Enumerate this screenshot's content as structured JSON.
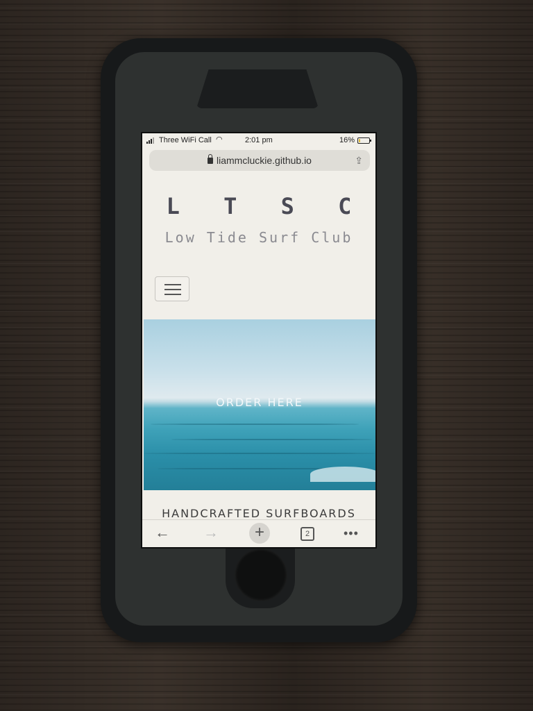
{
  "status_bar": {
    "carrier": "Three WiFi Call",
    "time": "2:01 pm",
    "battery_percent": "16%",
    "battery_level": 0.16
  },
  "browser": {
    "url": "liammcluckie.github.io",
    "open_tabs": "2"
  },
  "page": {
    "title": "L T S C",
    "subtitle": "Low Tide Surf Club",
    "hero_cta": "ORDER HERE",
    "section_heading": "HANDCRAFTED SURFBOARDS"
  },
  "icons": {
    "menu": "hamburger-icon",
    "lock": "lock-icon",
    "share": "share-icon",
    "back": "back-arrow-icon",
    "forward": "forward-arrow-icon",
    "new_tab": "plus-icon",
    "tabs": "tabs-icon",
    "more": "more-icon"
  },
  "colors": {
    "title": "#4a4a55",
    "subtitle": "#8a8a90",
    "page_background": "#f1efe9",
    "battery": "#e1b92d"
  }
}
